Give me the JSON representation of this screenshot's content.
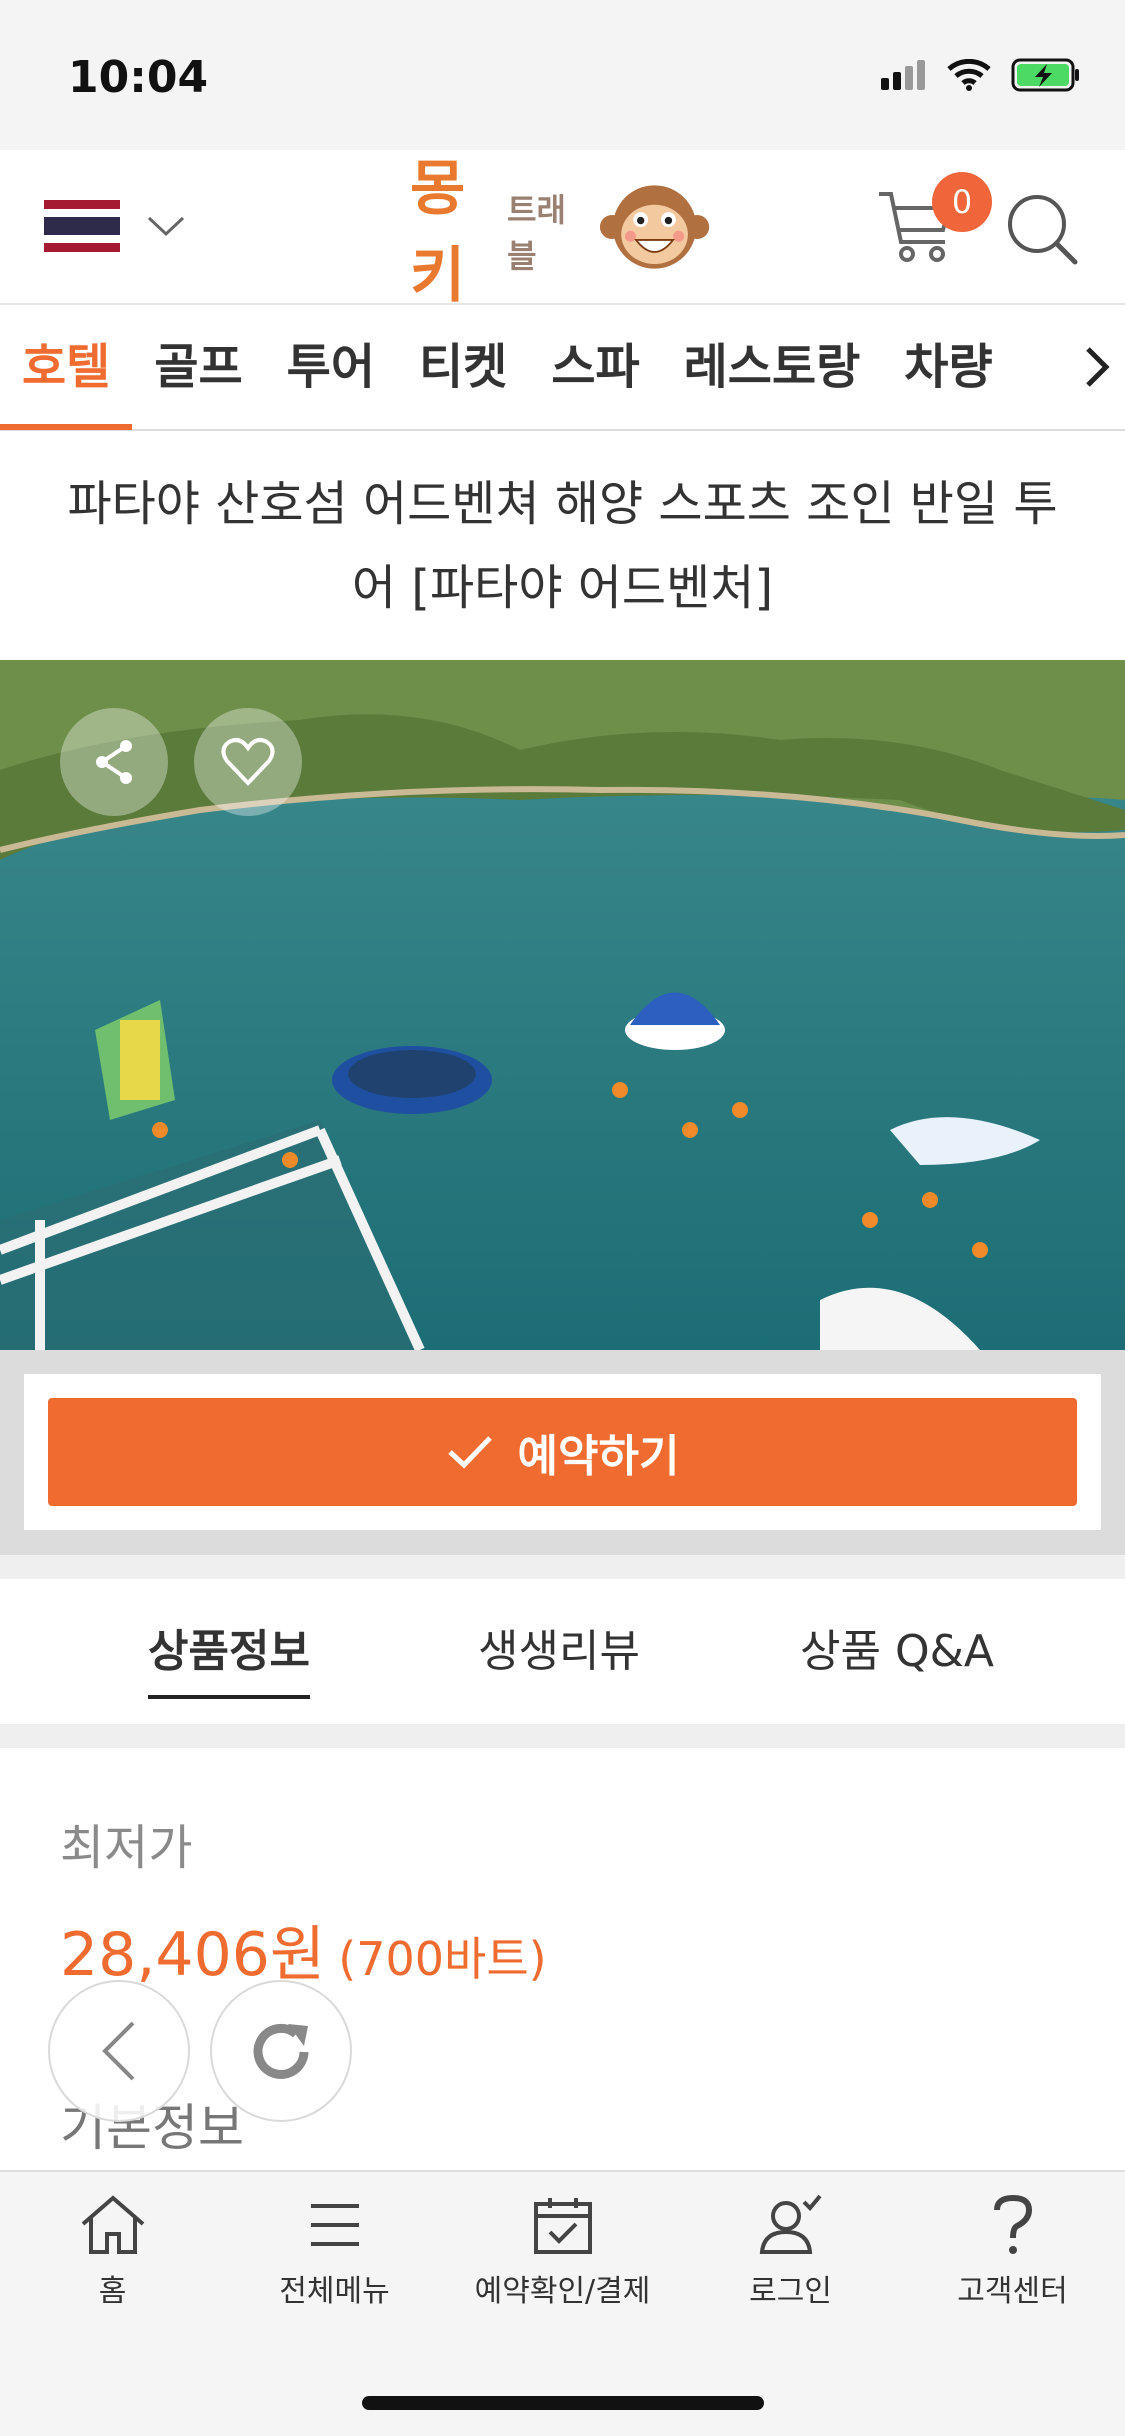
{
  "status_bar": {
    "time": "10:04"
  },
  "header": {
    "logo_main": "몽키",
    "logo_sub": "트래블",
    "cart_count": "0",
    "brand_color": "#ef6b30"
  },
  "categories": [
    {
      "label": "호텔",
      "active": true
    },
    {
      "label": "골프"
    },
    {
      "label": "투어"
    },
    {
      "label": "티켓"
    },
    {
      "label": "스파"
    },
    {
      "label": "레스토랑"
    },
    {
      "label": "차량"
    }
  ],
  "product": {
    "title": "파타야 산호섬 어드벤쳐 해양 스포츠 조인 반일 투어 [파타야 어드벤처]"
  },
  "reserve": {
    "label": "예약하기"
  },
  "info_tabs": [
    {
      "label": "상품정보",
      "active": true
    },
    {
      "label": "생생리뷰"
    },
    {
      "label": "상품 Q&A"
    }
  ],
  "price": {
    "lowest_label": "최저가",
    "krw": "28,406원",
    "thb": "(700바트)",
    "basic_info_label": "기본정보"
  },
  "bottom_nav": [
    {
      "label": "홈",
      "icon": "home-icon"
    },
    {
      "label": "전체메뉴",
      "icon": "menu-icon"
    },
    {
      "label": "예약확인/결제",
      "icon": "calendar-check-icon"
    },
    {
      "label": "로그인",
      "icon": "user-check-icon"
    },
    {
      "label": "고객센터",
      "icon": "question-icon"
    }
  ]
}
